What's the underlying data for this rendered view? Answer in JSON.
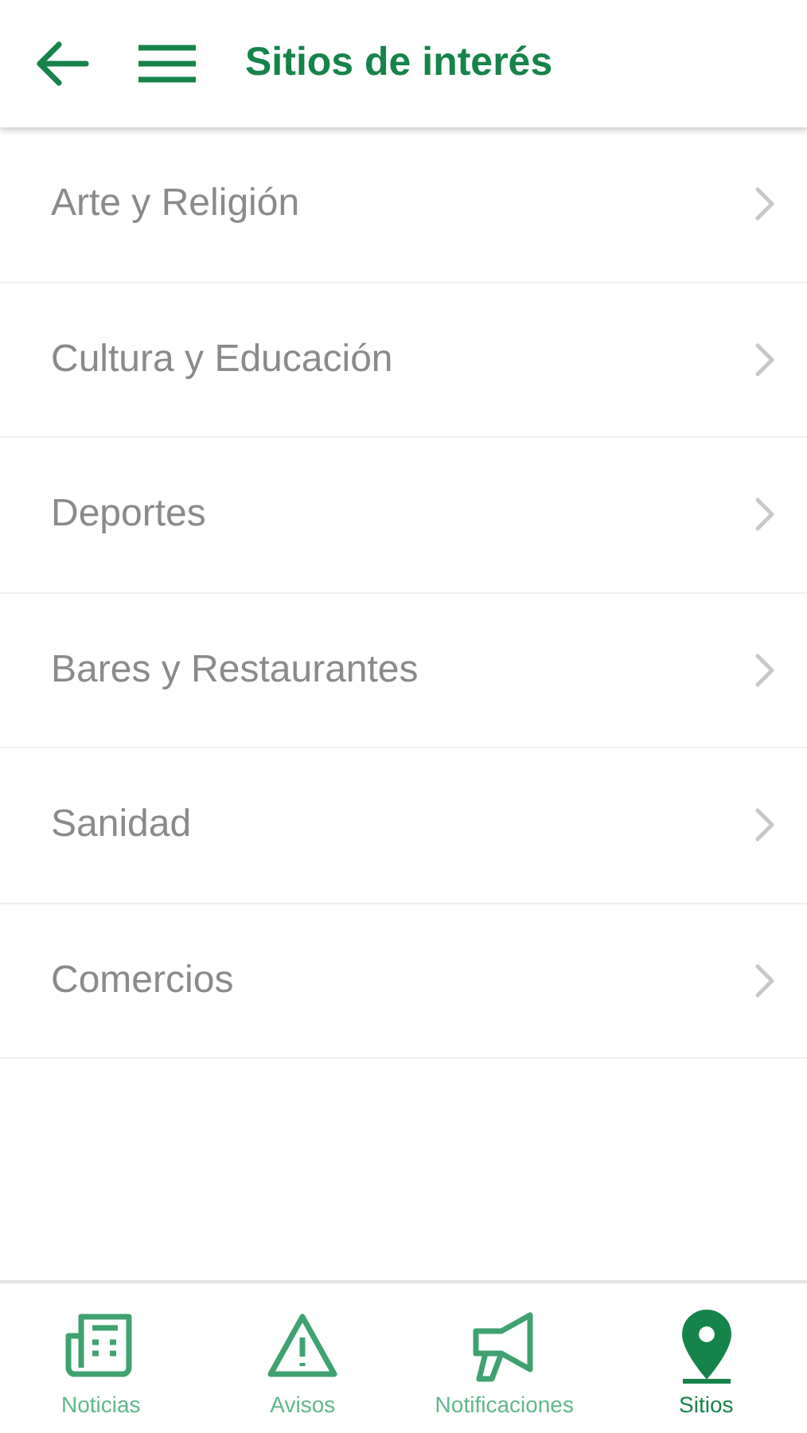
{
  "header": {
    "title": "Sitios de interés"
  },
  "categories": [
    {
      "label": "Arte y Religión"
    },
    {
      "label": "Cultura y Educación"
    },
    {
      "label": "Deportes"
    },
    {
      "label": "Bares y Restaurantes"
    },
    {
      "label": "Sanidad"
    },
    {
      "label": "Comercios"
    }
  ],
  "tabs": [
    {
      "label": "Noticias",
      "kind": "news",
      "selected": false
    },
    {
      "label": "Avisos",
      "kind": "warning",
      "selected": false
    },
    {
      "label": "Notificaciones",
      "kind": "megaphone",
      "selected": false
    },
    {
      "label": "Sitios",
      "kind": "pin",
      "selected": true
    }
  ]
}
